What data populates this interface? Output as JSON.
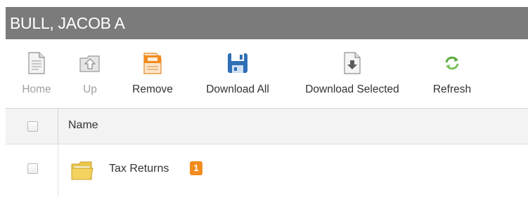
{
  "window": {
    "title": "BULL, JACOB A"
  },
  "toolbar": {
    "home_label": "Home",
    "up_label": "Up",
    "remove_label": "Remove",
    "download_all_label": "Download All",
    "download_selected_label": "Download Selected",
    "refresh_label": "Refresh",
    "icons": {
      "home": "document-icon",
      "up": "folder-up-icon",
      "remove": "remove-document-icon",
      "download_all": "floppy-disk-icon",
      "download_selected": "download-document-icon",
      "refresh": "refresh-icon"
    },
    "disabled": [
      "Home",
      "Up"
    ]
  },
  "table": {
    "columns": [
      "Name"
    ],
    "rows": [
      {
        "name": "Tax Returns",
        "icon": "folder-icon",
        "badge": "1",
        "checked": false
      }
    ]
  },
  "colors": {
    "title_bar": "#7b7b7b",
    "header_bg": "#f3f3f3",
    "badge": "#f28c1e",
    "accent_blue": "#2f6fb5",
    "refresh_green": "#5aac3c"
  }
}
